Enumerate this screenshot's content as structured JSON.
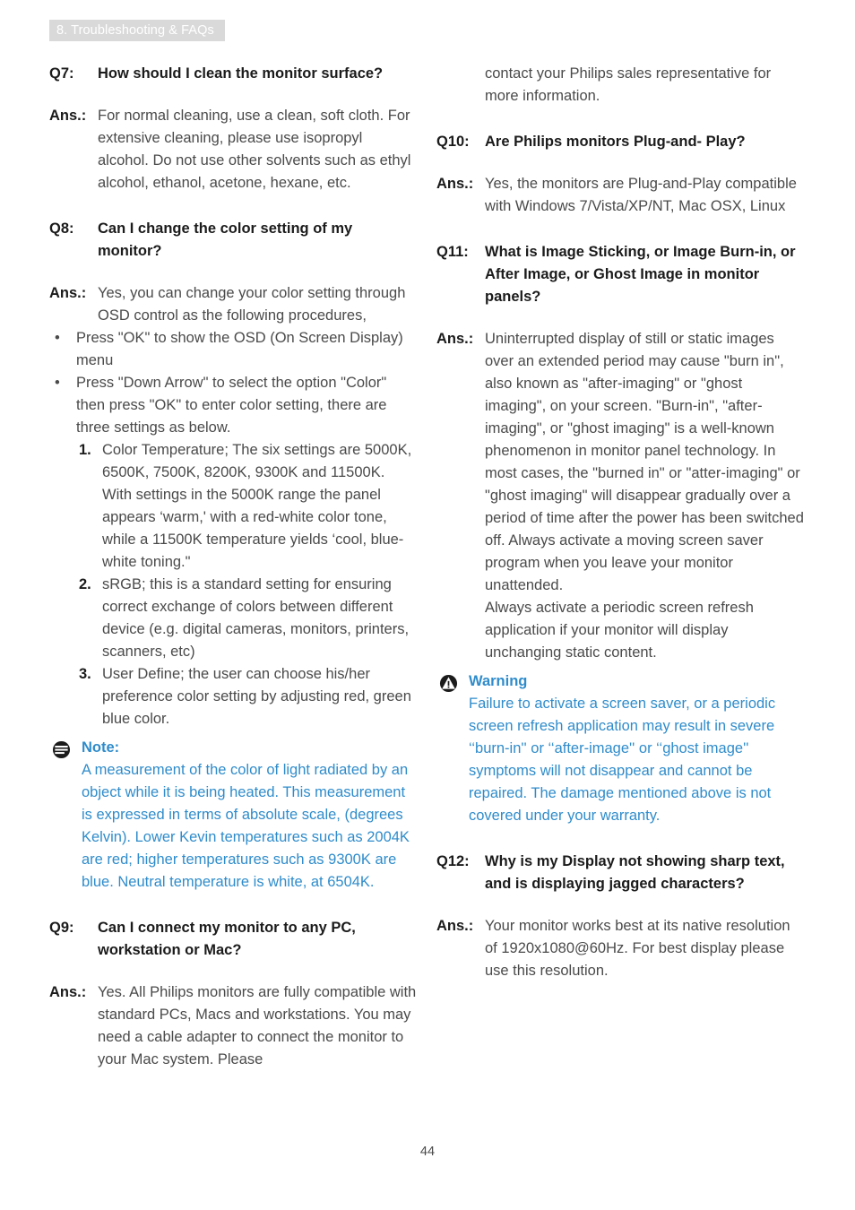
{
  "header": {
    "chapter_badge": "8. Troubleshooting & FAQs"
  },
  "page_number": "44",
  "colors": {
    "badge_background": "#d9d9d9",
    "badge_text": "#ffffff",
    "body_text": "#4a4a4a",
    "heading_text": "#1b1b1b",
    "callout_blue": "#2f8ccb"
  },
  "left_column": {
    "q7": {
      "tag": "Q7:",
      "question": "How should I clean the monitor surface?",
      "ans_tag": "Ans.:",
      "answer": "For normal cleaning, use a clean, soft cloth. For extensive cleaning, please use isopropyl alcohol. Do not use other solvents such as ethyl alcohol, ethanol, acetone, hexane, etc."
    },
    "q8": {
      "tag": "Q8:",
      "question": "Can I change the color setting of my monitor?",
      "ans_tag": "Ans.:",
      "answer": "Yes, you can change your color setting through OSD control as the following procedures,",
      "bullets": [
        "Press \"OK\" to show the OSD (On Screen Display) menu",
        "Press \"Down Arrow\" to select the option \"Color\" then press \"OK\" to enter color setting, there are three settings as below."
      ],
      "numbered": [
        {
          "mark": "1.",
          "text": "Color Temperature; The six settings are 5000K, 6500K, 7500K, 8200K, 9300K and 11500K. With settings in the 5000K range the panel appears ‘warm,' with a red-white color tone, while a 11500K temperature yields ‘cool, blue-white toning.\""
        },
        {
          "mark": "2.",
          "text": "sRGB; this is a standard setting for ensuring correct exchange of colors between different device (e.g. digital cameras, monitors, printers, scanners, etc)"
        },
        {
          "mark": "3.",
          "text": "User Define; the user can choose his/her preference color setting by adjusting red, green blue color."
        }
      ]
    },
    "note": {
      "icon": "note-icon",
      "title": "Note:",
      "text": "A measurement of the color of light radiated by an object while it is being heated. This measurement is expressed in terms of absolute scale, (degrees Kelvin). Lower Kevin temperatures such as 2004K are red; higher temperatures such as 9300K are blue. Neutral temperature is white, at 6504K."
    },
    "q9": {
      "tag": "Q9:",
      "question": "Can I connect my monitor to any PC, workstation or Mac?",
      "ans_tag": "Ans.:",
      "answer": "Yes. All Philips monitors are fully compatible with standard PCs, Macs and workstations. You may need a cable adapter to connect the monitor to your Mac system. Please"
    }
  },
  "right_column": {
    "continuation": "contact your Philips sales representative for more information.",
    "q10": {
      "tag": "Q10:",
      "question": "Are Philips monitors Plug-and- Play?",
      "ans_tag": "Ans.:",
      "answer": "Yes, the monitors are Plug-and-Play compatible with Windows 7/Vista/XP/NT, Mac OSX, Linux"
    },
    "q11": {
      "tag": "Q11:",
      "question": "What is Image Sticking, or Image Burn-in, or After Image, or Ghost Image in monitor panels?",
      "ans_tag": "Ans.:",
      "answer_part1": "Uninterrupted display of still or static images over an extended period may cause \"burn in\", also known as \"after-imaging\" or \"ghost imaging\", on your screen. \"Burn-in\", \"after-imaging\", or \"ghost imaging\" is a well-known phenomenon in monitor panel technology. In most cases, the \"burned in\" or \"atter-imaging\" or \"ghost imaging\" will disappear gradually over a period of time after the power has been switched off. Always activate a moving screen saver program when you leave your monitor unattended.",
      "answer_part2": "Always activate a periodic screen refresh application if your monitor will display unchanging static content."
    },
    "warning": {
      "icon": "warning-icon",
      "title": "Warning",
      "text": "Failure to activate a screen saver, or a periodic screen refresh application may result in severe ‘‘burn-in'' or ‘‘after-image'' or ‘‘ghost image'' symptoms will not disappear and cannot be repaired. The damage mentioned above is not covered under your warranty."
    },
    "q12": {
      "tag": "Q12:",
      "question": "Why is my Display not showing sharp text, and is displaying jagged characters?",
      "ans_tag": "Ans.:",
      "answer": "Your monitor works best at its native resolution of 1920x1080@60Hz. For best display please use this resolution."
    }
  }
}
